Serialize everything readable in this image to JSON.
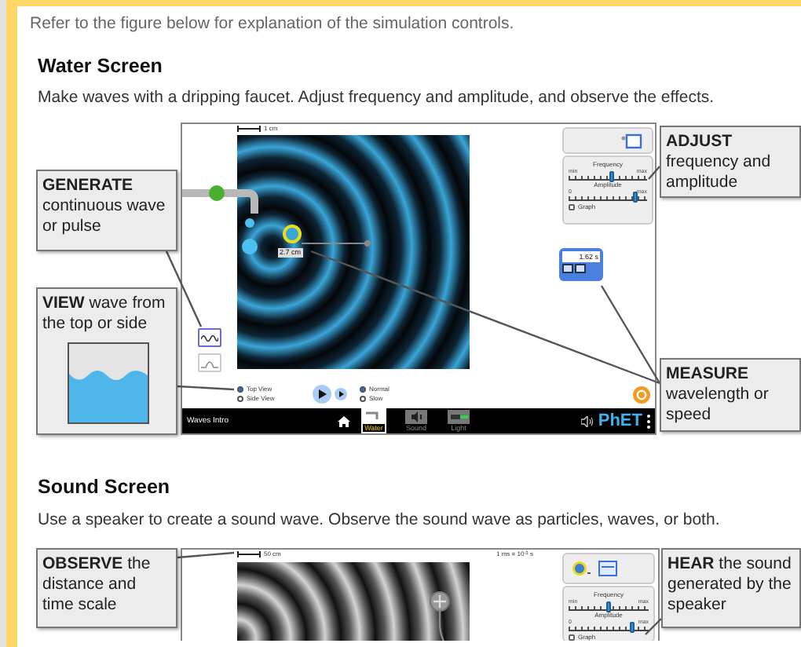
{
  "intro": "Refer to the figure below for explanation of the simulation controls.",
  "water_screen": {
    "heading": "Water Screen",
    "description": "Make waves with a dripping faucet. Adjust frequency and amplitude, and observe the effects.",
    "simulation": {
      "scale_label": "1 cm",
      "tape_reading": "2.7 cm",
      "wave_types": [
        {
          "kind": "continuous",
          "selected": true
        },
        {
          "kind": "pulse",
          "selected": false
        }
      ],
      "sliders": [
        {
          "label": "Frequency",
          "min": "min",
          "max": "max",
          "level": 0.55
        },
        {
          "label": "Amplitude",
          "min": "0",
          "max": "max",
          "level": 0.85
        }
      ],
      "graph": {
        "label": "Graph",
        "checked": false
      },
      "timer": {
        "reading": "1.62 s"
      },
      "view_options": [
        {
          "label": "Top View",
          "selected": true
        },
        {
          "label": "Side View",
          "selected": false
        }
      ],
      "speed_options": [
        {
          "label": "Normal",
          "selected": true
        },
        {
          "label": "Slow",
          "selected": false
        }
      ],
      "nav_bar": {
        "title": "Waves Intro",
        "screens": [
          {
            "kind": "faucet",
            "label": "Water",
            "selected": true
          },
          {
            "kind": "speaker",
            "label": "Sound",
            "selected": false
          },
          {
            "kind": "laser",
            "label": "Light",
            "selected": false
          }
        ],
        "logo": "PhET"
      }
    },
    "callouts": [
      {
        "kind": "text",
        "text": "**GENERATE** continuous wave or pulse"
      },
      {
        "kind": "side_view",
        "text": "**VIEW** wave from the top or side"
      },
      {
        "kind": "text",
        "text": "**ADJUST** frequency and amplitude"
      },
      {
        "kind": "text",
        "text": "**MEASURE** wavelength or speed"
      }
    ]
  },
  "sound_screen": {
    "heading": "Sound Screen",
    "description": "Use a speaker to create a sound wave. Observe the sound wave as particles, waves, or both.",
    "simulation": {
      "scale_label": "50 cm",
      "time_scale": "1 ms = 10$^{-3}$ s",
      "sliders": [
        {
          "label": "Frequency",
          "min": "min",
          "max": "max",
          "level": 0.5
        },
        {
          "label": "Amplitude",
          "min": "0",
          "max": "max",
          "level": 0.8
        }
      ],
      "graph": {
        "label": "Graph",
        "checked": false
      }
    },
    "callouts": [
      {
        "text": "**OBSERVE** the distance and time scale"
      },
      {
        "text": "**HEAR** the sound generated by the speaker"
      }
    ]
  }
}
